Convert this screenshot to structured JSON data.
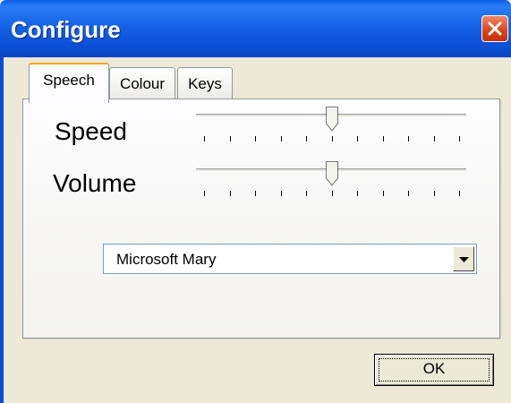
{
  "window": {
    "title": "Configure"
  },
  "tabs": [
    {
      "label": "Speech",
      "active": true
    },
    {
      "label": "Colour",
      "active": false
    },
    {
      "label": "Keys",
      "active": false
    }
  ],
  "speech": {
    "speed": {
      "label": "Speed",
      "value_fraction": 0.5,
      "ticks": 11
    },
    "volume": {
      "label": "Volume",
      "value_fraction": 0.5,
      "ticks": 11
    },
    "voice": {
      "selected": "Microsoft Mary"
    }
  },
  "buttons": {
    "ok": "OK"
  },
  "icons": {
    "close": "close-icon",
    "dropdown": "chevron-down-icon"
  },
  "colors": {
    "titlebar": "#0b4fd6",
    "close": "#d9421a",
    "active_tab_accent": "#f5a71c",
    "face": "#ece9d8"
  }
}
